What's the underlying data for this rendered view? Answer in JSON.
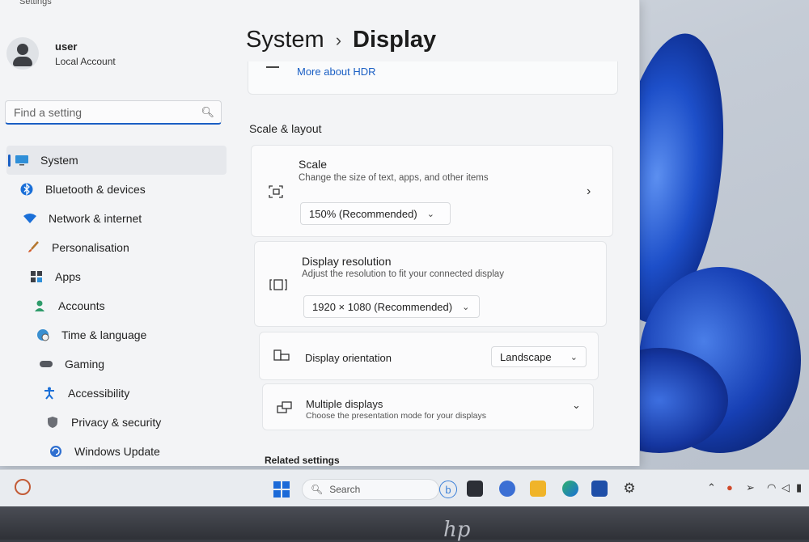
{
  "window": {
    "title": "Settings"
  },
  "user": {
    "name": "user",
    "account_type": "Local Account"
  },
  "search": {
    "placeholder": "Find a setting"
  },
  "sidebar": {
    "items": [
      {
        "label": "System",
        "icon": "monitor-icon",
        "active": true
      },
      {
        "label": "Bluetooth & devices",
        "icon": "bluetooth-icon"
      },
      {
        "label": "Network & internet",
        "icon": "wifi-icon"
      },
      {
        "label": "Personalisation",
        "icon": "brush-icon"
      },
      {
        "label": "Apps",
        "icon": "apps-icon"
      },
      {
        "label": "Accounts",
        "icon": "person-icon"
      },
      {
        "label": "Time & language",
        "icon": "globe-clock-icon"
      },
      {
        "label": "Gaming",
        "icon": "gamepad-icon"
      },
      {
        "label": "Accessibility",
        "icon": "accessibility-icon"
      },
      {
        "label": "Privacy & security",
        "icon": "shield-icon"
      },
      {
        "label": "Windows Update",
        "icon": "update-icon"
      }
    ]
  },
  "breadcrumb": {
    "parent": "System",
    "current": "Display"
  },
  "hdr": {
    "link": "More about HDR"
  },
  "section": {
    "scale_layout": "Scale & layout",
    "related": "Related settings"
  },
  "scale": {
    "title": "Scale",
    "description": "Change the size of text, apps, and other items",
    "value": "150% (Recommended)"
  },
  "resolution": {
    "title": "Display resolution",
    "description": "Adjust the resolution to fit your connected display",
    "value": "1920 × 1080 (Recommended)"
  },
  "orientation": {
    "title": "Display orientation",
    "value": "Landscape"
  },
  "multiple": {
    "title": "Multiple displays",
    "description": "Choose the presentation mode for your displays"
  },
  "taskbar": {
    "search_label": "Search"
  },
  "brand": {
    "logo_text": "hp"
  },
  "colors": {
    "accent": "#1a5fc4"
  }
}
